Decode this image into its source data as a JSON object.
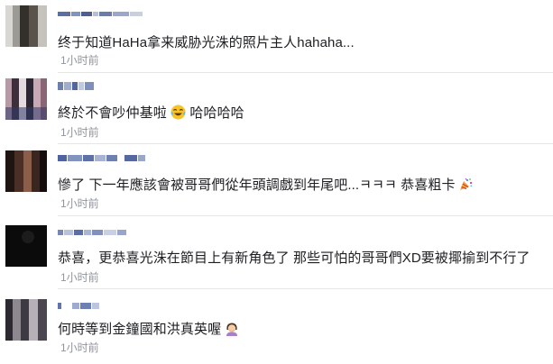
{
  "comments": [
    {
      "text": "终于知道HaHa拿来威胁光洙的照片主人hahaha...",
      "time": "1小时前"
    },
    {
      "text": "終於不會吵仲基啦",
      "emoji": "laughing-tears-emoji",
      "text_after": "哈哈哈哈",
      "time": "1小时前"
    },
    {
      "text": "慘了 下一年應該會被哥哥們從年頭調戲到年尾吧...ㅋㅋㅋ 恭喜粗卡",
      "emoji": "party-popper-emoji",
      "time": "1小时前"
    },
    {
      "text": "恭喜，更恭喜光洙在節目上有新角色了 那些可怕的哥哥們XD要被揶揄到不行了",
      "time": "1小时前"
    },
    {
      "text": "何時等到金鐘國和洪真英喔",
      "emoji": "woman-facepalming-emoji",
      "time": "1小时前"
    }
  ],
  "colors": {
    "text": "#1c1e21",
    "meta": "#90949c",
    "divider": "#e6e6e6",
    "name_blur": "#3b5998"
  }
}
